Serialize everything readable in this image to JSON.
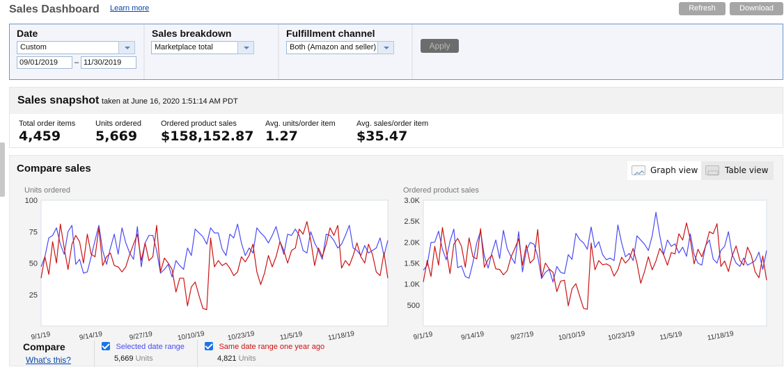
{
  "header": {
    "title": "Sales Dashboard",
    "learn_more": "Learn more",
    "refresh_label": "Refresh",
    "download_label": "Download"
  },
  "filters": {
    "date": {
      "label": "Date",
      "selected": "Custom",
      "from": "09/01/2019",
      "separator": "–",
      "to": "11/30/2019"
    },
    "sales_breakdown": {
      "label": "Sales breakdown",
      "selected": "Marketplace total"
    },
    "fulfillment_channel": {
      "label": "Fulfillment channel",
      "selected": "Both (Amazon and seller)"
    },
    "apply_label": "Apply"
  },
  "snapshot": {
    "title": "Sales snapshot",
    "subtitle": "taken at June 16, 2020 1:51:14 AM PDT",
    "metrics": [
      {
        "label": "Total order items",
        "value": "4,459"
      },
      {
        "label": "Units ordered",
        "value": "5,669"
      },
      {
        "label": "Ordered product sales",
        "value": "$158,152.87"
      },
      {
        "label": "Avg. units/order item",
        "value": "1.27"
      },
      {
        "label": "Avg. sales/order item",
        "value": "$35.47"
      }
    ]
  },
  "compare": {
    "title": "Compare sales",
    "graph_view_label": "Graph view",
    "table_view_label": "Table view",
    "active_view": "graph",
    "compare_label": "Compare",
    "whats_this": "What's this?",
    "legend": [
      {
        "name": "Selected date range",
        "checked": true,
        "color": "#4a4af4",
        "total": "5,669",
        "unit": "Units"
      },
      {
        "name": "Same date range one year ago",
        "checked": true,
        "color": "#cc1111",
        "total": "4,821",
        "unit": "Units"
      }
    ]
  },
  "colors": {
    "selected": "#4a4af4",
    "year_ago": "#cc1111",
    "link": "#0645ad"
  },
  "chart_data": [
    {
      "type": "line",
      "title": "Units ordered",
      "xlabel": "",
      "ylabel": "Units ordered",
      "ylim": [
        0,
        100
      ],
      "yticks": [
        "100",
        "75",
        "50",
        "25"
      ],
      "ytick_values": [
        100,
        75,
        50,
        25
      ],
      "x_start": "9/1/19",
      "x_end": "11/30/19",
      "xticks": [
        "9/1/19",
        "9/14/19",
        "9/27/19",
        "10/10/19",
        "10/23/19",
        "11/5/19",
        "11/18/19"
      ],
      "xtick_index": [
        0,
        13,
        26,
        39,
        52,
        65,
        78
      ],
      "grid": false,
      "legend": "bottom",
      "series": [
        {
          "name": "Selected date range",
          "color": "#4a4af4",
          "values": [
            47,
            55,
            70,
            72,
            78,
            65,
            57,
            75,
            80,
            49,
            53,
            42,
            43,
            55,
            68,
            80,
            60,
            49,
            62,
            73,
            57,
            78,
            66,
            58,
            53,
            79,
            47,
            66,
            72,
            72,
            60,
            42,
            45,
            49,
            39,
            52,
            48,
            45,
            62,
            56,
            77,
            74,
            71,
            65,
            78,
            74,
            74,
            61,
            56,
            73,
            70,
            81,
            66,
            56,
            62,
            58,
            78,
            74,
            71,
            66,
            72,
            79,
            67,
            57,
            73,
            72,
            77,
            72,
            60,
            58,
            75,
            66,
            60,
            53,
            73,
            72,
            68,
            62,
            65,
            72,
            80,
            62,
            60,
            56,
            64,
            58,
            60,
            62,
            70,
            56,
            68
          ]
        },
        {
          "name": "Same date range one year ago",
          "color": "#cc1111",
          "values": [
            38,
            55,
            41,
            67,
            50,
            81,
            62,
            45,
            65,
            72,
            67,
            50,
            73,
            57,
            55,
            78,
            48,
            55,
            58,
            48,
            47,
            43,
            47,
            57,
            65,
            73,
            52,
            66,
            52,
            55,
            80,
            43,
            54,
            50,
            45,
            27,
            38,
            38,
            16,
            31,
            35,
            24,
            14,
            13,
            70,
            47,
            52,
            48,
            50,
            46,
            40,
            43,
            55,
            51,
            56,
            65,
            43,
            33,
            42,
            56,
            47,
            55,
            67,
            60,
            50,
            60,
            62,
            77,
            73,
            83,
            68,
            48,
            62,
            55,
            65,
            78,
            72,
            80,
            46,
            52,
            48,
            56,
            66,
            55,
            50,
            65,
            57,
            43,
            40,
            58,
            38
          ]
        }
      ]
    },
    {
      "type": "line",
      "title": "Ordered product sales",
      "xlabel": "",
      "ylabel": "Ordered product sales",
      "ylim": [
        0,
        3000
      ],
      "yticks": [
        "3.0K",
        "2.5K",
        "2.0K",
        "1.5K",
        "1.0K",
        "500"
      ],
      "ytick_values": [
        3000,
        2500,
        2000,
        1500,
        1000,
        500
      ],
      "x_start": "9/1/19",
      "x_end": "11/30/19",
      "xticks": [
        "9/1/19",
        "9/14/19",
        "9/27/19",
        "10/10/19",
        "10/23/19",
        "11/5/19",
        "11/18/19"
      ],
      "xtick_index": [
        0,
        13,
        26,
        39,
        52,
        65,
        78
      ],
      "grid": false,
      "legend": "bottom",
      "series": [
        {
          "name": "Selected date range",
          "color": "#4a4af4",
          "values": [
            1330,
            1450,
            1990,
            2000,
            2260,
            1830,
            1580,
            2020,
            2310,
            1390,
            1430,
            1180,
            1140,
            1510,
            1980,
            2260,
            1670,
            1380,
            1750,
            2050,
            1610,
            2280,
            1840,
            1650,
            1490,
            2250,
            1290,
            1800,
            1990,
            1950,
            1660,
            1130,
            1280,
            1350,
            1050,
            1420,
            1280,
            1250,
            1700,
            1590,
            2210,
            2060,
            1980,
            1830,
            2360,
            1870,
            2010,
            1700,
            1580,
            1620,
            1560,
            2410,
            1980,
            1650,
            1730,
            1560,
            2150,
            2050,
            1950,
            1800,
            2150,
            2710,
            2150,
            1700,
            2050,
            1900,
            1960,
            1740,
            1880,
            1660,
            2200,
            1700,
            1500,
            1450,
            1920,
            2050,
            1600,
            1500,
            1800,
            1900,
            2250,
            1700,
            1500,
            1420,
            1620,
            1450,
            1500,
            1560,
            1760,
            1350,
            1800
          ]
        },
        {
          "name": "Same date range one year ago",
          "color": "#cc1111",
          "values": [
            1050,
            1560,
            1180,
            1900,
            1450,
            2350,
            1800,
            1250,
            1950,
            2090,
            1900,
            1400,
            2100,
            1650,
            1600,
            2320,
            1400,
            1590,
            1690,
            1360,
            1350,
            1220,
            1320,
            1650,
            1850,
            2080,
            1450,
            1930,
            1500,
            1600,
            2300,
            1160,
            1500,
            1360,
            1280,
            820,
            1070,
            1090,
            480,
            890,
            1010,
            710,
            420,
            400,
            1980,
            1340,
            1560,
            1460,
            1480,
            1430,
            1190,
            1340,
            1640,
            1500,
            1600,
            1850,
            1500,
            1020,
            1300,
            1650,
            1340,
            1550,
            1850,
            1700,
            1450,
            1750,
            1720,
            2200,
            2050,
            2460,
            2060,
            1480,
            1830,
            1650,
            1900,
            2250,
            2200,
            2440,
            1420,
            1550,
            1300,
            1680,
            1910,
            1560,
            1450,
            1880,
            1680,
            1290,
            1150,
            1670,
            1090
          ]
        }
      ]
    }
  ]
}
